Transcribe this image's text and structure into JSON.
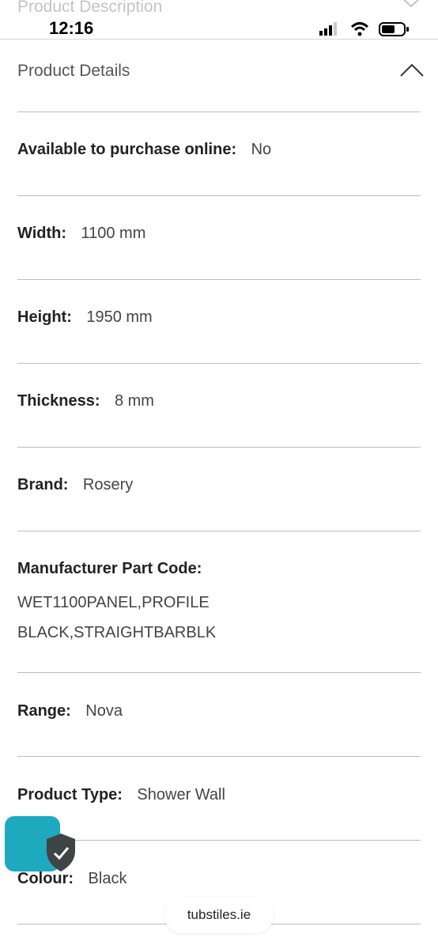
{
  "previous_section": {
    "title": "Product Description"
  },
  "status_bar": {
    "time": "12:16"
  },
  "section": {
    "title": "Product Details"
  },
  "details": [
    {
      "label": "Available to purchase online:",
      "value": "No"
    },
    {
      "label": "Width:",
      "value": "1100 mm"
    },
    {
      "label": "Height:",
      "value": "1950 mm"
    },
    {
      "label": "Thickness:",
      "value": "8 mm"
    },
    {
      "label": "Brand:",
      "value": "Rosery"
    },
    {
      "label": "Manufacturer Part Code:",
      "value_lines": [
        "WET1100PANEL,PROFILE",
        "BLACK,STRAIGHTBARBLK"
      ]
    },
    {
      "label": "Range:",
      "value": "Nova"
    },
    {
      "label": "Product Type:",
      "value": "Shower Wall"
    },
    {
      "label": "Colour:",
      "value": "Black"
    }
  ],
  "browser": {
    "url": "tubstiles.ie"
  },
  "colors": {
    "accent": "#1fa9bf",
    "text": "#222222",
    "divider": "#bdbdbd"
  },
  "icons": {
    "chat": "chat-widget",
    "shield": "shield-check-icon"
  }
}
